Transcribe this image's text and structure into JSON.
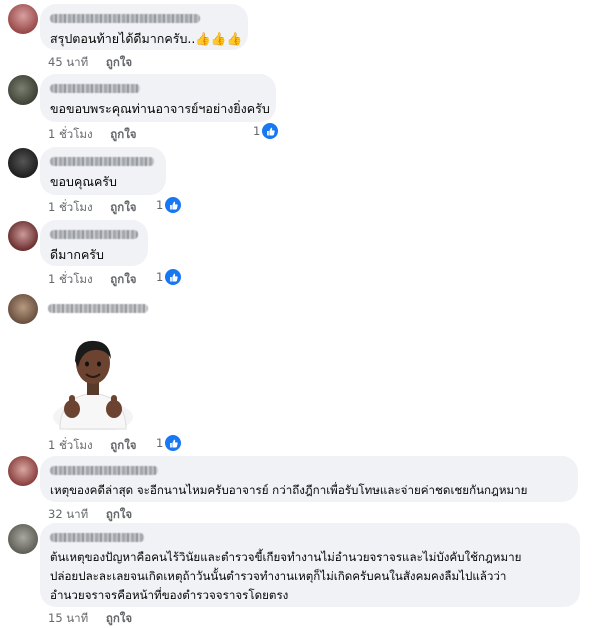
{
  "comments": [
    {
      "text": "สรุปตอนท้ายได้ดีมากครับ..👍👍👍",
      "time": "45 นาที",
      "like_label": "ถูกใจ"
    },
    {
      "text": "ขอขอบพระคุณท่านอาจารย์ฯอย่างยิ่งครับ",
      "time": "1 ชั่วโมง",
      "like_label": "ถูกใจ",
      "reaction_count": "1"
    },
    {
      "text": "ขอบคุณครับ",
      "time": "1 ชั่วโมง",
      "like_label": "ถูกใจ",
      "reaction_count": "1"
    },
    {
      "text": "ดีมากครับ",
      "time": "1 ชั่วโมง",
      "like_label": "ถูกใจ",
      "reaction_count": "1"
    },
    {
      "time": "1 ชั่วโมง",
      "like_label": "ถูกใจ",
      "reaction_count": "1",
      "sticker": "thumbs-up-character"
    },
    {
      "text": "เหตุของคดีล่าสุด จะอีกนานไหมครับอาจารย์ กว่าถึงฎีกาเพื่อรับโทษและจ่ายค่าชดเชยกันกฎหมาย",
      "time": "32 นาที",
      "like_label": "ถูกใจ"
    },
    {
      "lines": [
        "ต้นเหตุของปัญหาคือคนไร้วินัยและตำรวจขี้เกียจทำงานไม่อำนวยจราจรและไม่บังคับใช้กฎหมาย",
        "ปล่อยปละละเลยจนเกิดเหตุถ้าวันนั้นตำรวจทำงานเหตุก็ไม่เกิดครับคนในสังคมคงลืมไปแล้วว่า",
        "อำนวยจราจรคือหน้าที่ของตำรวจจราจรโดยตรง"
      ],
      "time": "15 นาที",
      "like_label": "ถูกใจ"
    }
  ],
  "colors": {
    "bubble": "#f0f2f5",
    "meta": "#65676b",
    "like_blue": "#1877f2"
  }
}
